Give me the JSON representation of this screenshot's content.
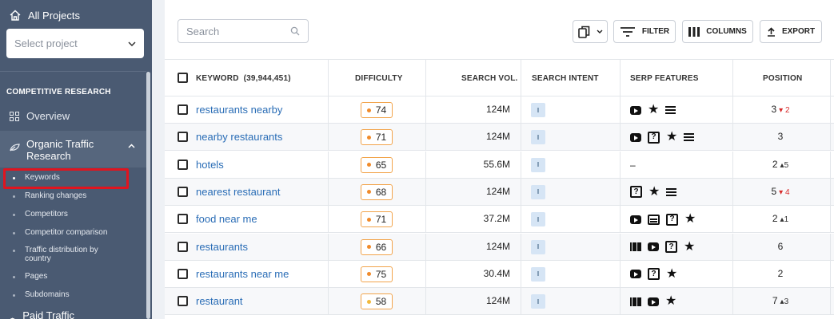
{
  "sidebar": {
    "all_projects": "All Projects",
    "select_placeholder": "Select project",
    "section_title": "COMPETITIVE RESEARCH",
    "overview": "Overview",
    "organic": "Organic Traffic Research",
    "sub_items": [
      {
        "label": "Keywords"
      },
      {
        "label": "Ranking changes"
      },
      {
        "label": "Competitors"
      },
      {
        "label": "Competitor comparison"
      },
      {
        "label": "Traffic distribution by country"
      },
      {
        "label": "Pages"
      },
      {
        "label": "Subdomains"
      }
    ],
    "paid": "Paid Traffic Research"
  },
  "toolbar": {
    "search_placeholder": "Search",
    "filter": "FILTER",
    "columns": "COLUMNS",
    "export": "EXPORT"
  },
  "table": {
    "headers": {
      "keyword": "KEYWORD",
      "keyword_count": "(39,944,451)",
      "difficulty": "DIFFICULTY",
      "search_vol": "SEARCH VOL.",
      "intent": "SEARCH INTENT",
      "serp": "SERP FEATURES",
      "position": "POSITION"
    },
    "rows": [
      {
        "keyword": "restaurants nearby",
        "difficulty": "74",
        "volume": "124M",
        "intent": "I",
        "serp": [
          "video-icon",
          "star-icon",
          "list-icon"
        ],
        "position": "3",
        "change": "2",
        "dir": "down"
      },
      {
        "keyword": "nearby restaurants",
        "difficulty": "71",
        "volume": "124M",
        "intent": "I",
        "serp": [
          "video-icon",
          "faq-icon",
          "star-icon",
          "list-icon"
        ],
        "position": "3",
        "change": "",
        "dir": ""
      },
      {
        "keyword": "hotels",
        "difficulty": "65",
        "volume": "55.6M",
        "intent": "I",
        "serp": [
          "dash"
        ],
        "position": "2",
        "change": "5",
        "dir": "up"
      },
      {
        "keyword": "nearest restaurant",
        "difficulty": "68",
        "volume": "124M",
        "intent": "I",
        "serp": [
          "faq-icon",
          "star-icon",
          "list-icon"
        ],
        "position": "5",
        "change": "4",
        "dir": "down"
      },
      {
        "keyword": "food near me",
        "difficulty": "71",
        "volume": "37.2M",
        "intent": "I",
        "serp": [
          "video-icon",
          "shopping-icon",
          "faq-icon",
          "star-icon"
        ],
        "position": "2",
        "change": "1",
        "dir": "up"
      },
      {
        "keyword": "restaurants",
        "difficulty": "66",
        "volume": "124M",
        "intent": "I",
        "serp": [
          "images-icon",
          "video-icon",
          "faq-icon",
          "star-icon"
        ],
        "position": "6",
        "change": "",
        "dir": ""
      },
      {
        "keyword": "restaurants near me",
        "difficulty": "75",
        "volume": "30.4M",
        "intent": "I",
        "serp": [
          "video-icon",
          "faq-icon",
          "star-icon"
        ],
        "position": "2",
        "change": "",
        "dir": ""
      },
      {
        "keyword": "restaurant",
        "difficulty": "58",
        "volume": "124M",
        "intent": "I",
        "serp": [
          "images-icon",
          "video-icon",
          "star-icon"
        ],
        "position": "7",
        "change": "3",
        "dir": "up"
      }
    ]
  },
  "colors": {
    "sidebar_bg": "#4a5a72",
    "link": "#2a6db6",
    "difficulty_border": "#f2a44b",
    "highlight": "#e0141f"
  }
}
